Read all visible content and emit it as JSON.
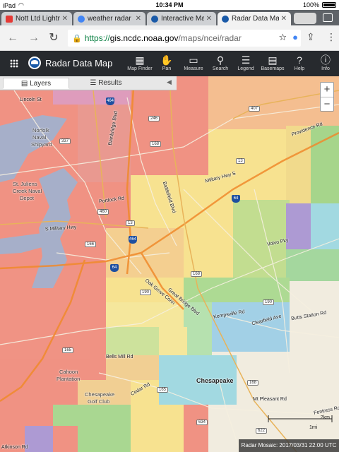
{
  "status_bar": {
    "carrier": "iPad",
    "time": "10:34 PM",
    "battery": "100%"
  },
  "browser": {
    "tabs": [
      {
        "title": "Nott Ltd Lightni",
        "icon": "youtube-icon",
        "color": "#e53935"
      },
      {
        "title": "weather radar arc",
        "icon": "google-icon",
        "color": "#4285f4"
      },
      {
        "title": "Interactive Map T",
        "icon": "noaa-icon",
        "color": "#1a5aa8"
      },
      {
        "title": "Radar Data Map |",
        "icon": "noaa-icon",
        "color": "#1a5aa8"
      }
    ],
    "url_secure": "https://",
    "url_host": "gis.ncdc.noaa.gov",
    "url_path": "/maps/ncei/radar"
  },
  "app": {
    "title": "Radar Data Map",
    "tools": [
      {
        "label": "Map Finder",
        "icon": "map-finder-icon",
        "glyph": "▦"
      },
      {
        "label": "Pan",
        "icon": "hand-icon",
        "glyph": "✋"
      },
      {
        "label": "Measure",
        "icon": "ruler-icon",
        "glyph": "▭"
      },
      {
        "label": "Search",
        "icon": "search-icon",
        "glyph": "⚲"
      },
      {
        "label": "Legend",
        "icon": "legend-icon",
        "glyph": "☰"
      },
      {
        "label": "Basemaps",
        "icon": "basemaps-icon",
        "glyph": "▤"
      },
      {
        "label": "Help",
        "icon": "help-icon",
        "glyph": "?"
      },
      {
        "label": "Info",
        "icon": "info-icon",
        "glyph": "ⓘ"
      }
    ]
  },
  "panel": {
    "tabs": [
      "Layers",
      "Results"
    ],
    "active": "Layers"
  },
  "map": {
    "labels": [
      {
        "text": "Norfolk",
        "cls": "place"
      },
      {
        "text": "Naval",
        "cls": "place"
      },
      {
        "text": "Shipyard",
        "cls": "place"
      },
      {
        "text": "St. Juliens",
        "cls": "place"
      },
      {
        "text": "Creek Naval",
        "cls": "place"
      },
      {
        "text": "Depot",
        "cls": "place"
      },
      {
        "text": "Chesapeake",
        "cls": "big"
      },
      {
        "text": "Cahoon",
        "cls": "place"
      },
      {
        "text": "Plantation",
        "cls": "place"
      },
      {
        "text": "Chesapeake",
        "cls": "place"
      },
      {
        "text": "Golf Club",
        "cls": "place"
      },
      {
        "text": "Military Hwy S",
        "cls": ""
      },
      {
        "text": "S Military Hwy",
        "cls": ""
      },
      {
        "text": "Volvo Pky",
        "cls": ""
      },
      {
        "text": "Battlefield Blvd",
        "cls": ""
      },
      {
        "text": "Bainbridge Blvd",
        "cls": ""
      },
      {
        "text": "Portlock Rd",
        "cls": ""
      },
      {
        "text": "Great Bridge Blvd",
        "cls": ""
      },
      {
        "text": "Kempsville Rd",
        "cls": ""
      },
      {
        "text": "Clearfield Ave",
        "cls": ""
      },
      {
        "text": "Butts Station Rd",
        "cls": ""
      },
      {
        "text": "Cedar Rd",
        "cls": ""
      },
      {
        "text": "Mt Pleasant Rd",
        "cls": ""
      },
      {
        "text": "Fentress Rd",
        "cls": ""
      },
      {
        "text": "Atkinson Rd",
        "cls": ""
      },
      {
        "text": "Providence Rd",
        "cls": ""
      },
      {
        "text": "Lincoln St",
        "cls": ""
      },
      {
        "text": "Oak Grove Conn",
        "cls": ""
      },
      {
        "text": "Bells Mill Rd",
        "cls": ""
      }
    ],
    "routes": [
      "464",
      "246",
      "168",
      "337",
      "460",
      "13",
      "407",
      "13",
      "166",
      "464",
      "64",
      "64",
      "190",
      "168",
      "190",
      "165",
      "168",
      "165",
      "634",
      "622"
    ],
    "scale_km": "2km",
    "scale_mi": "1mi",
    "mosaic_label": "Radar Mosaic: 2017/03/31 22:00 UTC"
  }
}
